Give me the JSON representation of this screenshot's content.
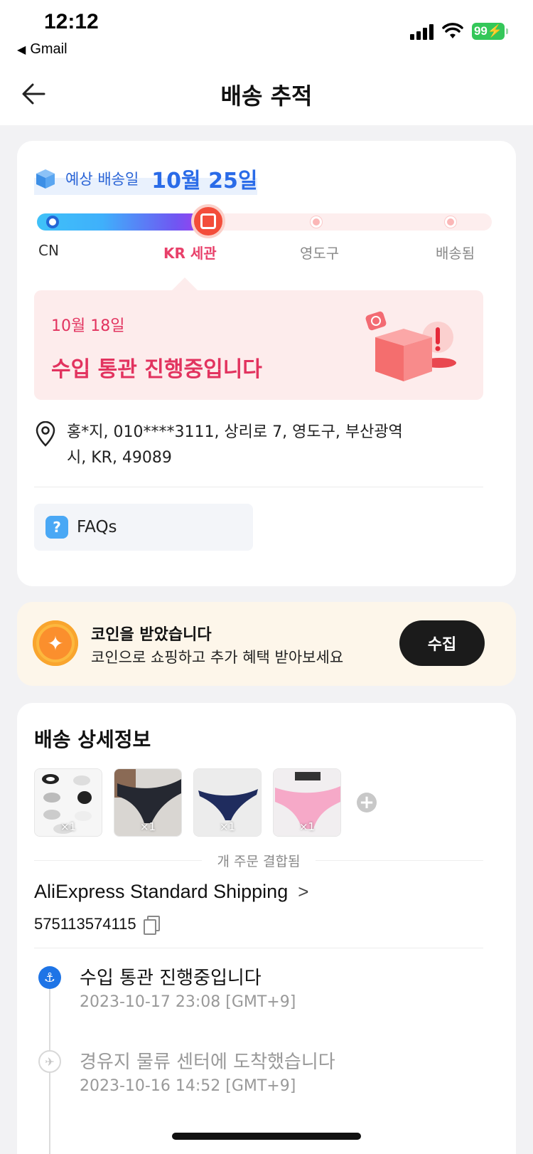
{
  "status_bar": {
    "time": "12:12",
    "back_app": "Gmail",
    "battery": "99"
  },
  "header": {
    "title": "배송 추적"
  },
  "eta": {
    "label": "예상 배송일",
    "date": "10월 25일"
  },
  "steps": [
    {
      "label": "CN",
      "state": "done"
    },
    {
      "label": "KR 세관",
      "state": "current"
    },
    {
      "label": "영도구",
      "state": "pending"
    },
    {
      "label": "배송됨",
      "state": "pending"
    }
  ],
  "progress_fraction": 0.36,
  "notice": {
    "date": "10월 18일",
    "text": "수입 통관 진행중입니다"
  },
  "address": {
    "line1": "홍*지,  010****3111,  상리로 7,  영도구,  부산광역",
    "line2": "시,  KR,  49089"
  },
  "faq": {
    "label": "FAQs"
  },
  "coin": {
    "title": "코인을 받았습니다",
    "subtitle": "코인으로 쇼핑하고 추가 혜택 받아보세요",
    "button": "수집"
  },
  "details": {
    "heading": "배송 상세정보",
    "thumbnails": [
      {
        "qty": "×1"
      },
      {
        "qty": "×1"
      },
      {
        "qty": "×1"
      },
      {
        "qty": "×1"
      }
    ],
    "combined_text": "개 주문 결합됨",
    "carrier": "AliExpress Standard Shipping",
    "tracking_number": "575113574115",
    "events": [
      {
        "title": "수입 통관 진행중입니다",
        "time": "2023-10-17 23:08 [GMT+9]",
        "state": "active",
        "icon": "anchor-icon"
      },
      {
        "title": "경유지 물류 센터에 도착했습니다",
        "time": "2023-10-16 14:52 [GMT+9]",
        "state": "muted",
        "icon": "airplane-icon"
      }
    ]
  },
  "colors": {
    "accent_blue": "#2a6be8",
    "alert_pink": "#e2335f",
    "coin_orange": "#fb8f2d",
    "dark_button": "#1b1b1b"
  }
}
